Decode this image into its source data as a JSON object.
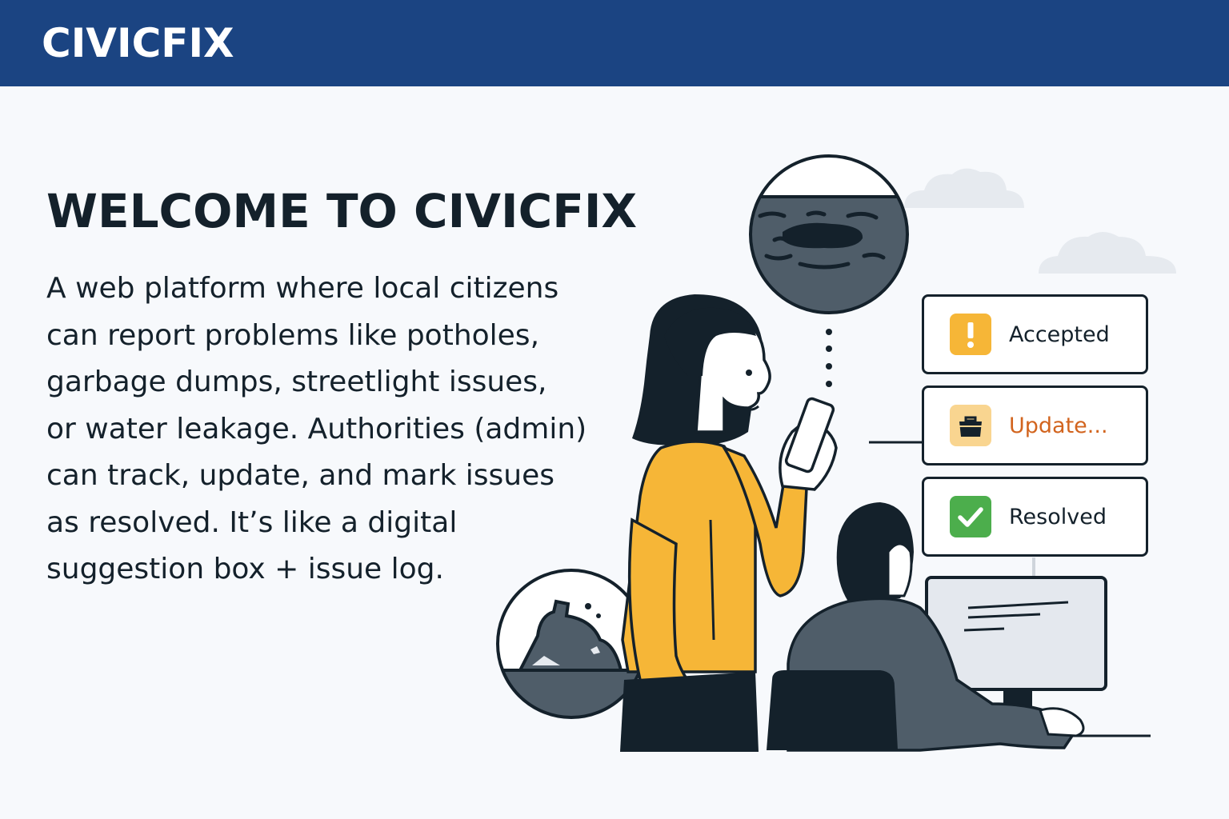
{
  "header": {
    "brand": "CIVICFIX"
  },
  "hero": {
    "title": "WELCOME TO CIVICFIX",
    "description_lines": [
      "A web platform where local citizens",
      "can report problems like potholes,",
      "garbage dumps, streetlight issues,",
      "or water leakage. Authorities (admin)",
      "can track, update, and mark issues",
      "as resolved. It’s like a digital",
      "suggestion box + issue log."
    ]
  },
  "statuses": [
    {
      "label": "Accepted",
      "icon": "exclamation-icon",
      "icon_bg": "#f6b637",
      "label_color": "#14212b"
    },
    {
      "label": "Update...",
      "icon": "toolbox-icon",
      "icon_bg": "#f9d590",
      "label_color": "#d2641e"
    },
    {
      "label": "Resolved",
      "icon": "check-icon",
      "icon_bg": "#4cae4c",
      "label_color": "#14212b"
    }
  ],
  "colors": {
    "header_bg": "#1b4482",
    "ink": "#14212b",
    "sweater": "#f6b637",
    "slate": "#4f5d69"
  }
}
